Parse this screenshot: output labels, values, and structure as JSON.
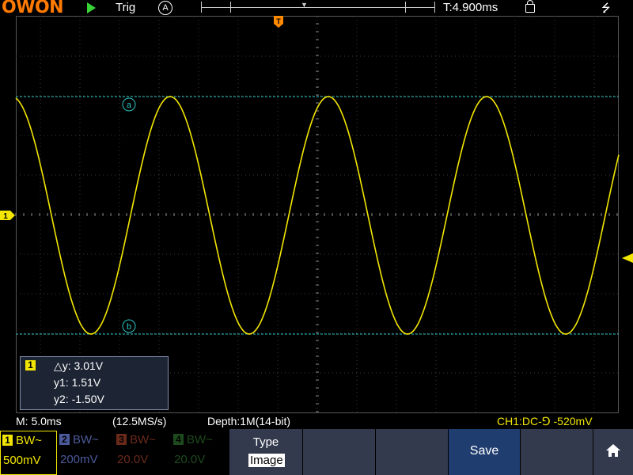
{
  "topbar": {
    "logo": "OWON",
    "trigger_label": "Trig",
    "trigger_mode_icon": "A",
    "time_offset": "T:4.900ms",
    "run_state_icon": "play-icon",
    "lock_icon": "lock-icon",
    "usb_icon": "usb-icon"
  },
  "waveform": {
    "channel": "CH1",
    "color": "#f2e600",
    "cursor_color": "#2ec4c4",
    "shape": "sine",
    "cursor_a_label": "a",
    "cursor_b_label": "b",
    "trigger_marker": "T",
    "ch1_marker": "1"
  },
  "cursor_box": {
    "channel_badge": "1",
    "delta_y": "△y: 3.01V",
    "y1": "y1: 1.51V",
    "y2": "y2: -1.50V"
  },
  "status": {
    "timebase": "M: 5.0ms",
    "sample_rate": "(12.5MS/s)",
    "depth": "Depth:1M(14-bit)",
    "trigger_info": "CH1:DC-⅁ -520mV"
  },
  "channels": [
    {
      "num": "1",
      "bw": "BW~",
      "volts": "500mV"
    },
    {
      "num": "2",
      "bw": "BW~",
      "volts": "200mV"
    },
    {
      "num": "3",
      "bw": "BW~",
      "volts": "20.0V"
    },
    {
      "num": "4",
      "bw": "BW~",
      "volts": "20.0V"
    }
  ],
  "menu": {
    "type_label": "Type",
    "type_value": "Image",
    "save_label": "Save",
    "home_icon": "home-icon"
  }
}
